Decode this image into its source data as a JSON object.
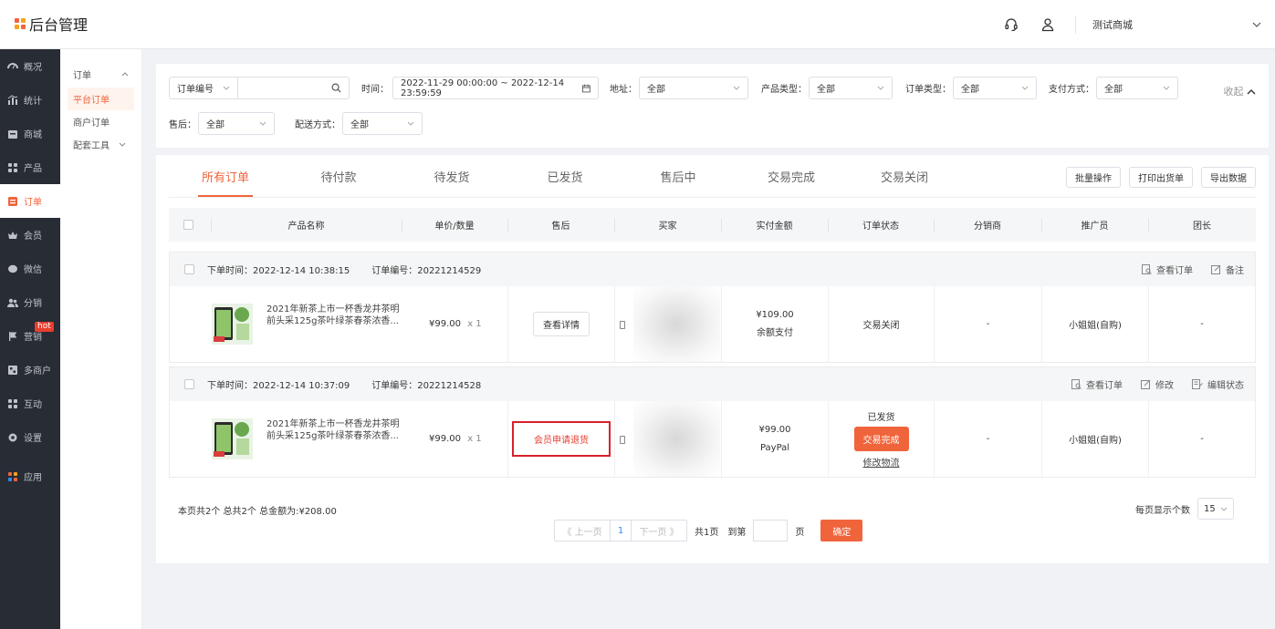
{
  "app": {
    "title": "后台管理",
    "shop_name": "测试商城"
  },
  "colors": {
    "accent": "#f0643c",
    "sidebar_bg": "#282c34",
    "highlight_border": "#d9202a"
  },
  "sidebar": {
    "items": [
      {
        "label": "概况",
        "icon": "dashboard-icon"
      },
      {
        "label": "统计",
        "icon": "chart-icon"
      },
      {
        "label": "商城",
        "icon": "store-icon"
      },
      {
        "label": "产品",
        "icon": "grid-icon"
      },
      {
        "label": "订单",
        "icon": "order-icon"
      },
      {
        "label": "会员",
        "icon": "crown-icon"
      },
      {
        "label": "微信",
        "icon": "wechat-icon"
      },
      {
        "label": "分销",
        "icon": "users-icon"
      },
      {
        "label": "营销",
        "icon": "flag-icon",
        "badge": "hot"
      },
      {
        "label": "多商户",
        "icon": "shop-icon"
      },
      {
        "label": "互动",
        "icon": "grid-icon"
      },
      {
        "label": "设置",
        "icon": "gear-icon"
      },
      {
        "label": "应用",
        "icon": "apps-icon"
      }
    ]
  },
  "submenu": {
    "group": "订单",
    "items": [
      "平台订单",
      "商户订单"
    ],
    "tools": "配套工具"
  },
  "filters": {
    "order_field": "订单编号",
    "time_label": "时间：",
    "time_range": "2022-11-29 00:00:00 ~ 2022-12-14 23:59:59",
    "address_label": "地址：",
    "address_value": "全部",
    "product_type_label": "产品类型：",
    "product_type_value": "全部",
    "order_type_label": "订单类型：",
    "order_type_value": "全部",
    "payment_label": "支付方式：",
    "payment_value": "全部",
    "collapse": "收起",
    "aftersale_label": "售后：",
    "aftersale_value": "全部",
    "delivery_label": "配送方式：",
    "delivery_value": "全部"
  },
  "tabs": [
    "所有订单",
    "待付款",
    "待发货",
    "已发货",
    "售后中",
    "交易完成",
    "交易关闭"
  ],
  "actions": [
    "批量操作",
    "打印出货单",
    "导出数据"
  ],
  "table": {
    "headers": [
      "产品名称",
      "单价/数量",
      "售后",
      "买家",
      "实付金额",
      "订单状态",
      "分销商",
      "推广员",
      "团长"
    ]
  },
  "orders": [
    {
      "time_label": "下单时间：2022-12-14 10:38:15",
      "no_label": "订单编号：20221214529",
      "ops": [
        "查看订单",
        "备注"
      ],
      "product_name": "2021年新茶上市一杯香龙井茶明前头采125g茶叶绿茶春茶浓香...",
      "price": "¥99.00",
      "qty": "x 1",
      "aftersale": "查看详情",
      "amount": "¥109.00",
      "pay_method": "余额支付",
      "status": "交易关闭",
      "distributor": "-",
      "promoter": "小姐姐(自购)",
      "leader": "-"
    },
    {
      "time_label": "下单时间：2022-12-14 10:37:09",
      "no_label": "订单编号：20221214528",
      "ops": [
        "查看订单",
        "修改",
        "编辑状态"
      ],
      "product_name": "2021年新茶上市一杯香龙井茶明前头采125g茶叶绿茶春茶浓香...",
      "price": "¥99.00",
      "qty": "x 1",
      "aftersale": "会员申请退货",
      "amount": "¥99.00",
      "pay_method": "PayPal",
      "status": "已发货",
      "status_button": "交易完成",
      "status_link": "修改物流",
      "distributor": "-",
      "promoter": "小姐姐(自购)",
      "leader": "-"
    }
  ],
  "summary": "本页共2个  总共2个  总金额为:¥208.00",
  "pager": {
    "prev": "《 上一页",
    "current": "1",
    "next": "下一页 》",
    "total": "共1页",
    "goto": "到第",
    "page_unit": "页",
    "confirm": "确定",
    "size_label": "每页显示个数",
    "size_value": "15"
  }
}
